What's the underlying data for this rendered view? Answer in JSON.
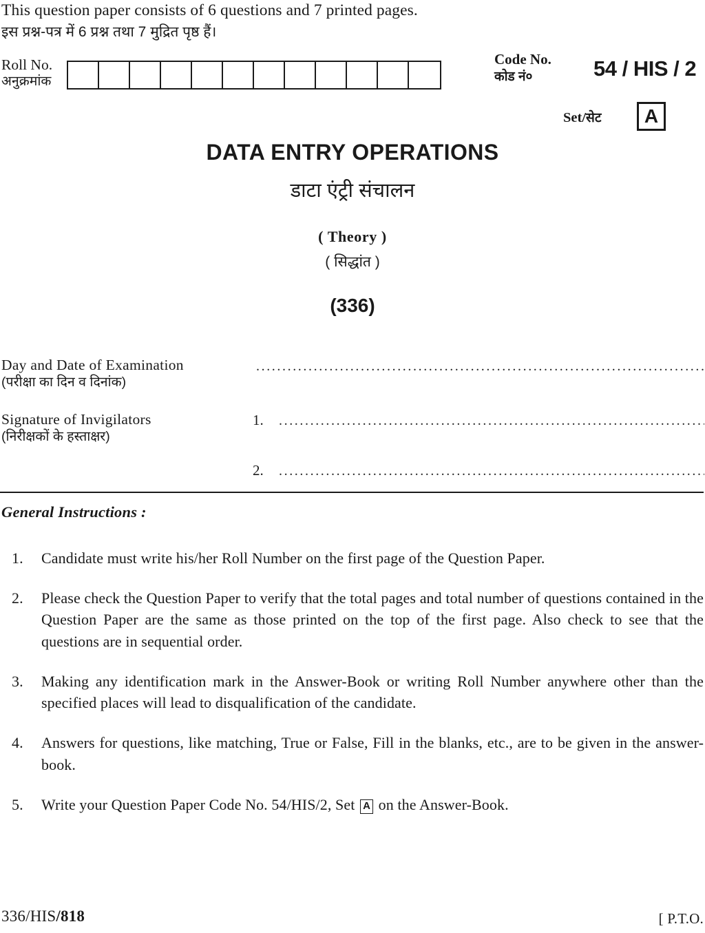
{
  "header": {
    "pages_note_en": "This question paper consists of 6 questions and 7 printed pages.",
    "pages_note_hi": "इस प्रश्न-पत्र में 6 प्रश्न तथा 7 मुद्रित पृष्ठ हैं।",
    "roll_no_label_en": "Roll No.",
    "roll_no_label_hi": "अनुक्रमांक",
    "roll_no_cells": 12,
    "code_no_label_en": "Code No.",
    "code_no_label_hi": "कोड नं०",
    "code_no_value": "54 / HIS / 2",
    "set_label_en": "Set/",
    "set_label_hi": "सेट",
    "set_value": "A"
  },
  "title": {
    "subject_en": "DATA ENTRY OPERATIONS",
    "subject_hi": "डाटा एंट्री संचालन",
    "type_en": "( Theory )",
    "type_hi": "( सिद्धांत )",
    "paper_code": "(336)"
  },
  "exam_details": {
    "day_date_en": "Day and Date of Examination",
    "day_date_hi": "(परीक्षा का दिन व दिनांक)",
    "signature_en": "Signature of Invigilators",
    "signature_hi": "(निरीक्षकों के हस्ताक्षर)",
    "sig_num_1": "1.",
    "sig_num_2": "2.",
    "dots": "............................................................................................................"
  },
  "instructions": {
    "heading": "General Instructions :",
    "items": [
      {
        "num": "1.",
        "text": "Candidate must write his/her Roll Number on the first page of the Question Paper."
      },
      {
        "num": "2.",
        "text": "Please check the Question Paper to verify that the total pages and total number of questions contained in the Question Paper are the same as those printed on the top of the first page. Also check to see that the questions are in sequential order."
      },
      {
        "num": "3.",
        "text": "Making any identification mark in the Answer-Book or writing Roll Number anywhere other than the specified places will lead to disqualification of the candidate."
      },
      {
        "num": "4.",
        "text": "Answers for questions, like matching, True or False, Fill in the blanks, etc., are to be given in the answer-book."
      },
      {
        "num": "5.",
        "text_before": "Write your Question Paper Code No. 54/HIS/2, Set",
        "boxed": "A",
        "text_after": "on the Answer-Book."
      }
    ]
  },
  "footer": {
    "left_plain": "336/HIS",
    "left_bold": "/818",
    "right": "[ P.T.O."
  },
  "colors": {
    "ink": "#1a1a1a",
    "paper": "#ffffff"
  }
}
